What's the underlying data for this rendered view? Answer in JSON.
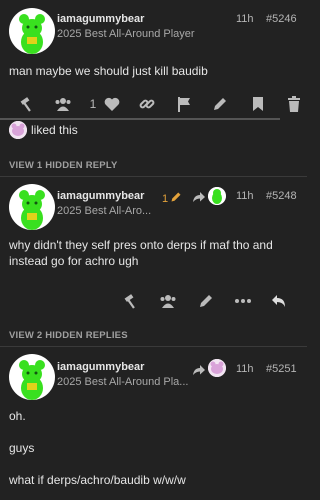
{
  "posts": [
    {
      "username": "iamagummybear",
      "user_title": "2025 Best All-Around Player",
      "time": "11h",
      "number": "#5246",
      "body_lines": [
        "man maybe we should just kill baudib"
      ],
      "like_count": "1",
      "liked_by_text": "liked this"
    },
    {
      "username": "iamagummybear",
      "user_title": "2025 Best All-Aro...",
      "edit_count": "1",
      "time": "11h",
      "number": "#5248",
      "body_lines": [
        "why didn't they self pres onto derps if maf tho and",
        "instead go for achro ugh"
      ]
    },
    {
      "username": "iamagummybear",
      "user_title": "2025 Best All-Around Pla...",
      "time": "11h",
      "number": "#5251",
      "body_lines": [
        "oh.",
        "guys",
        "what if derps/achro/baudib w/w/w"
      ]
    }
  ],
  "hidden_replies": [
    "VIEW 1 HIDDEN REPLY",
    "VIEW 2 HIDDEN REPLIES"
  ],
  "colors": {
    "background": "#222222",
    "text": "#e6e6e6",
    "muted": "#a8a8a8",
    "icons": "#bbbbbb",
    "accent_orange": "#e4a23b",
    "bear_green": "#39e01f"
  },
  "icons": [
    "hammer-icon",
    "users-icon",
    "heart-icon",
    "link-icon",
    "flag-icon",
    "pencil-icon",
    "bookmark-icon",
    "trash-icon",
    "ellipsis-icon",
    "reply-icon",
    "share-arrow-icon"
  ]
}
